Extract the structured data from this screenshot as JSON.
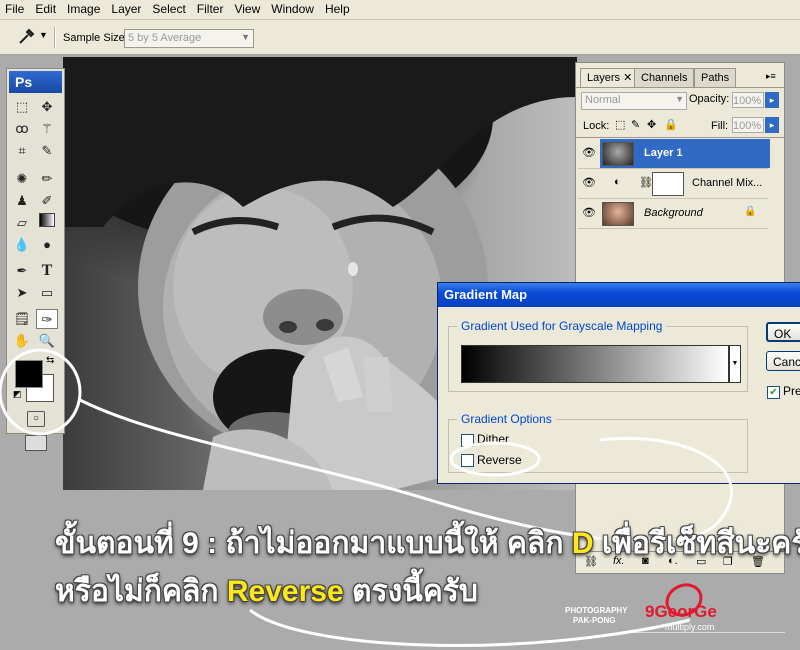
{
  "menu": [
    "File",
    "Edit",
    "Image",
    "Layer",
    "Select",
    "Filter",
    "View",
    "Window",
    "Help"
  ],
  "options": {
    "sample_size_label": "Sample Size:",
    "sample_size_value": "5 by 5 Average"
  },
  "toolbox": {
    "logo": "Ps"
  },
  "layers_panel": {
    "tabs": [
      "Layers",
      "Channels",
      "Paths"
    ],
    "blend_mode": "Normal",
    "opacity_label": "Opacity:",
    "opacity_value": "100%",
    "lock_label": "Lock:",
    "fill_label": "Fill:",
    "fill_value": "100%",
    "layers": [
      {
        "name": "Layer 1",
        "selected": true
      },
      {
        "name": "Channel Mix...",
        "selected": false
      },
      {
        "name": "Background",
        "selected": false,
        "locked": true
      }
    ]
  },
  "dialog": {
    "title": "Gradient Map",
    "group1_label": "Gradient Used for Grayscale Mapping",
    "group2_label": "Gradient Options",
    "dither_label": "Dither",
    "reverse_label": "Reverse",
    "ok_label": "OK",
    "cancel_label": "Cancel",
    "preview_label": "Preview",
    "preview_checked": true
  },
  "overlay": {
    "line1_a": "ขั้นตอนที่ 9 : ถ้าไม่ออกมาแบบนี้ให้ คลิก ",
    "line1_key": "D",
    "line1_b": " เพื่อรีเซ็ทสีนะครับ",
    "line2_a": "หรือไม่ก็คลิก ",
    "line2_key": "Reverse",
    "line2_b": " ตรงนี้ครับ"
  },
  "watermark": {
    "left": "PHOTOGRAPHY",
    "left2": "PAK-PONG",
    "brand": "9GeorGe",
    "site": "multiply.com"
  },
  "colors": {
    "accent": "#316ac5",
    "highlight": "#ffe81a",
    "title_bar": "#0a4cd6"
  }
}
